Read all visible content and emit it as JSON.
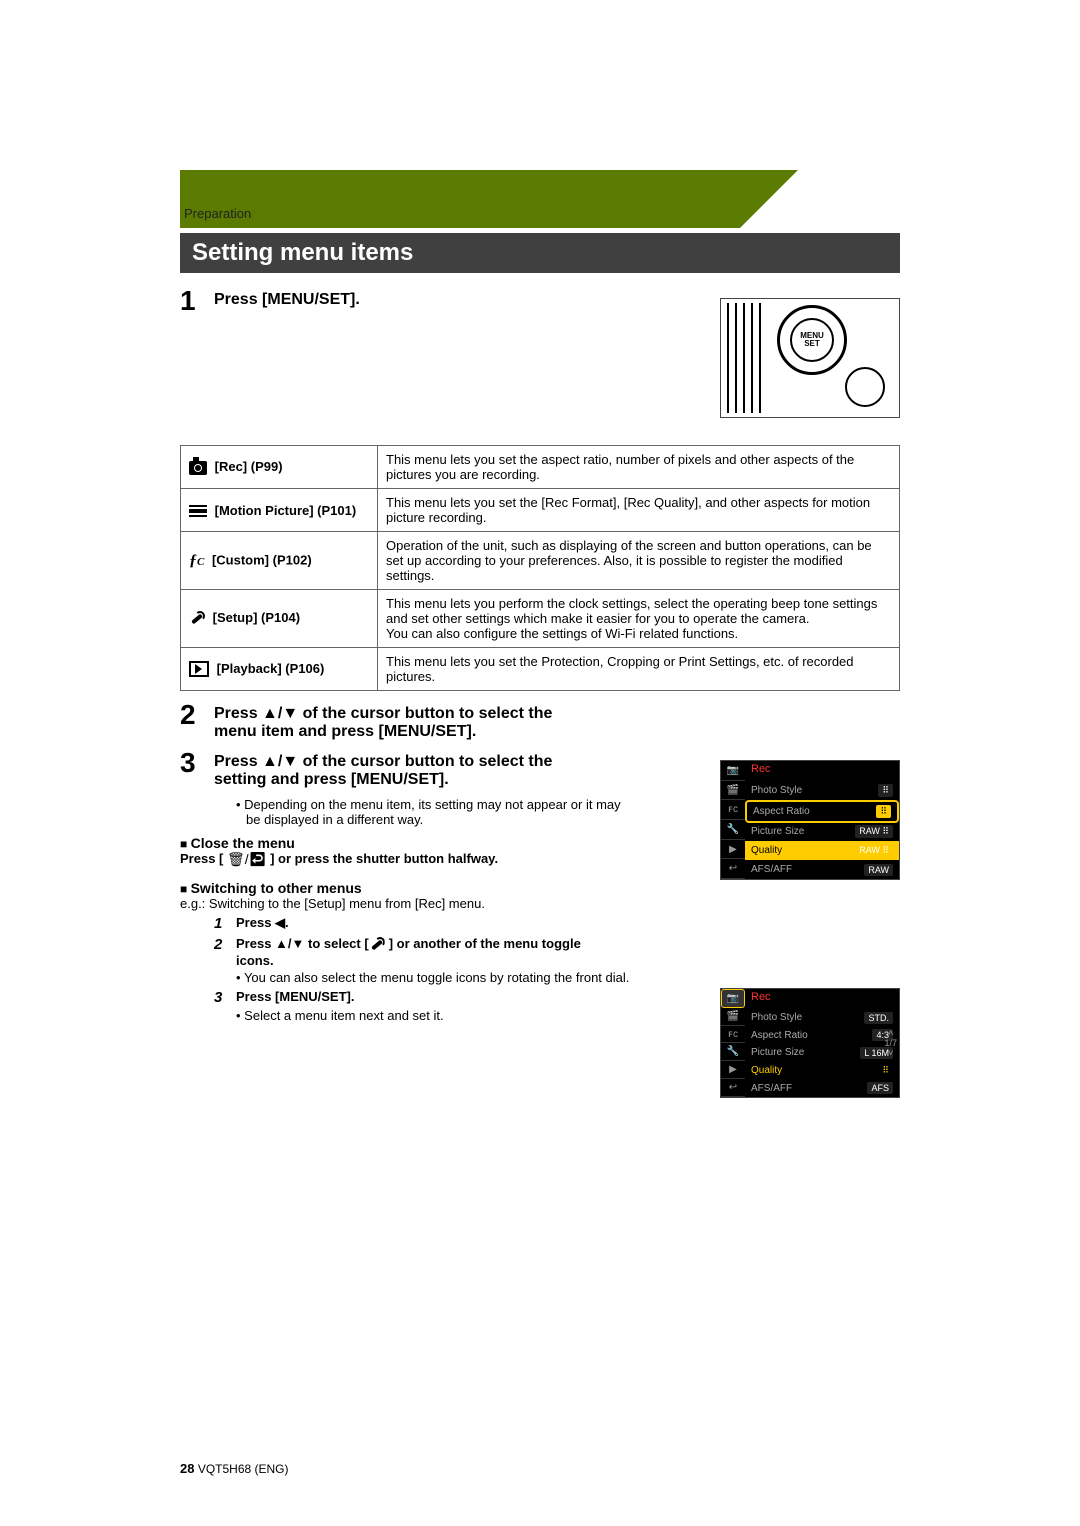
{
  "section_label": "Preparation",
  "title": "Setting menu items",
  "step1": {
    "num": "1",
    "text": "Press [MENU/SET]."
  },
  "menu_btn_label": "MENU\nSET",
  "table": {
    "rows": [
      {
        "icon": "camera",
        "label": "[Rec] (P99)",
        "desc": "This menu lets you set the aspect ratio, number of pixels and other aspects of the pictures you are recording."
      },
      {
        "icon": "movie",
        "label": "[Motion Picture] (P101)",
        "desc": "This menu lets you set the [Rec Format], [Rec Quality], and other aspects for motion picture recording."
      },
      {
        "icon": "fc",
        "label": "[Custom] (P102)",
        "desc": "Operation of the unit, such as displaying of the screen and button operations, can be set up according to your preferences. Also, it is possible to register the modified settings."
      },
      {
        "icon": "wrench",
        "label": "[Setup] (P104)",
        "desc": "This menu lets you perform the clock settings, select the operating beep tone settings and set other settings which make it easier for you to operate the camera.\nYou can also configure the settings of Wi-Fi related functions."
      },
      {
        "icon": "play",
        "label": "[Playback] (P106)",
        "desc": "This menu lets you set the Protection, Cropping or Print Settings, etc. of recorded pictures."
      }
    ]
  },
  "step2": {
    "num": "2",
    "text": "Press ▲/▼ of the cursor button to select the menu item and press [MENU/SET]."
  },
  "step3": {
    "num": "3",
    "text": "Press ▲/▼ of the cursor button to select the setting and press [MENU/SET].",
    "bullet": "Depending on the menu item, its setting may not appear or it may be displayed in a different way."
  },
  "close_menu": {
    "head": "Close the menu",
    "line_a": "Press [",
    "line_b": "] or press the shutter button halfway."
  },
  "switch": {
    "head": "Switching to other menus",
    "eg": "e.g.: Switching to the [Setup] menu from [Rec] menu.",
    "s1": {
      "num": "1",
      "text": "Press ◀."
    },
    "s2": {
      "num": "2",
      "text_a": "Press ▲/▼ to select [",
      "text_b": "] or another of the menu toggle icons.",
      "bullet": "You can also select the menu toggle icons by rotating the front dial."
    },
    "s3": {
      "num": "3",
      "text": "Press [MENU/SET].",
      "bullet": "Select a menu item next and set it."
    }
  },
  "lcd1": {
    "title": "Rec",
    "tabs": [
      "📷",
      "🎬",
      "ꜰᴄ",
      "🔧",
      "▶",
      "↩"
    ],
    "rows": [
      {
        "label": "Photo Style",
        "val": "⠿"
      },
      {
        "label": "Aspect Ratio",
        "val": "⠿"
      },
      {
        "label": "Picture Size",
        "val": "RAW ⠿"
      },
      {
        "label": "Quality",
        "val": "RAW ⠿",
        "sel": true
      },
      {
        "label": "AFS/AFF",
        "val": "RAW"
      }
    ]
  },
  "lcd2": {
    "title": "Rec",
    "tabs": [
      "📷",
      "🎬",
      "ꜰᴄ",
      "🔧",
      "▶",
      "↩"
    ],
    "side": {
      "up": "˄",
      "page": "1/7",
      "down": "˅"
    },
    "rows": [
      {
        "label": "Photo Style",
        "val": "STD."
      },
      {
        "label": "Aspect Ratio",
        "val": "4:3"
      },
      {
        "label": "Picture Size",
        "val": "L 16M"
      },
      {
        "label": "Quality",
        "val": "⠿",
        "sel": true
      },
      {
        "label": "AFS/AFF",
        "val": "AFS"
      }
    ]
  },
  "footer": {
    "page": "28",
    "code": "VQT5H68 (ENG)"
  }
}
